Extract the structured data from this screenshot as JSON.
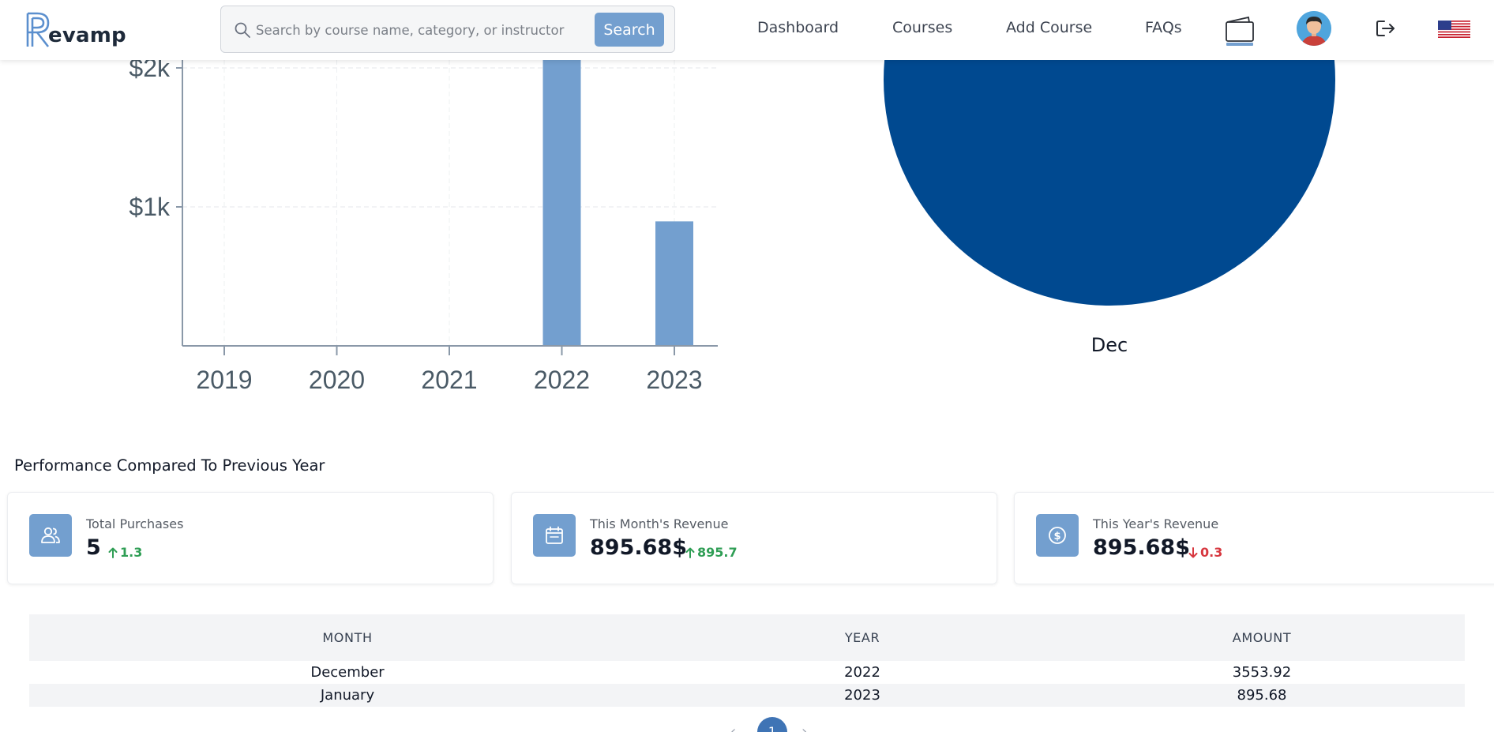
{
  "header": {
    "logo_text": "evamp",
    "search_placeholder": "Search by course name, category, or instructor",
    "search_button": "Search",
    "nav": [
      "Dashboard",
      "Courses",
      "Add Course",
      "FAQs"
    ],
    "icons": [
      "wallet-icon",
      "avatar",
      "logout-icon",
      "us-flag-icon"
    ]
  },
  "chart_data": [
    {
      "type": "bar",
      "categories": [
        "2019",
        "2020",
        "2021",
        "2022",
        "2023"
      ],
      "values": [
        0,
        0,
        0,
        3553.92,
        895.68
      ],
      "y_ticks": [
        "$1k",
        "$2k"
      ],
      "ylim": [
        0,
        2000
      ],
      "grid": true,
      "color": "#739fcf"
    },
    {
      "type": "pie",
      "labels": [
        "Dec"
      ],
      "values": [
        3553.92
      ],
      "color": "#004990"
    }
  ],
  "performance": {
    "title": "Performance Compared To Previous Year",
    "cards": [
      {
        "label": "Total Purchases",
        "value": "5",
        "delta": "1.3",
        "direction": "up",
        "icon": "users-icon"
      },
      {
        "label": "This Month's Revenue",
        "value": "895.68$",
        "delta": "895.7",
        "direction": "up",
        "icon": "calendar-icon"
      },
      {
        "label": "This Year's Revenue",
        "value": "895.68$",
        "delta": "0.3",
        "direction": "down",
        "icon": "dollar-coin-icon"
      }
    ]
  },
  "table": {
    "headers": [
      "MONTH",
      "YEAR",
      "AMOUNT"
    ],
    "rows": [
      [
        "December",
        "2022",
        "3553.92"
      ],
      [
        "January",
        "2023",
        "895.68"
      ]
    ]
  },
  "pagination": {
    "current_page": "1"
  },
  "colors": {
    "accent": "#739fcf",
    "pie": "#004990",
    "up": "#2f9e55",
    "down": "#d7373f",
    "page_active": "#3f74b5"
  }
}
